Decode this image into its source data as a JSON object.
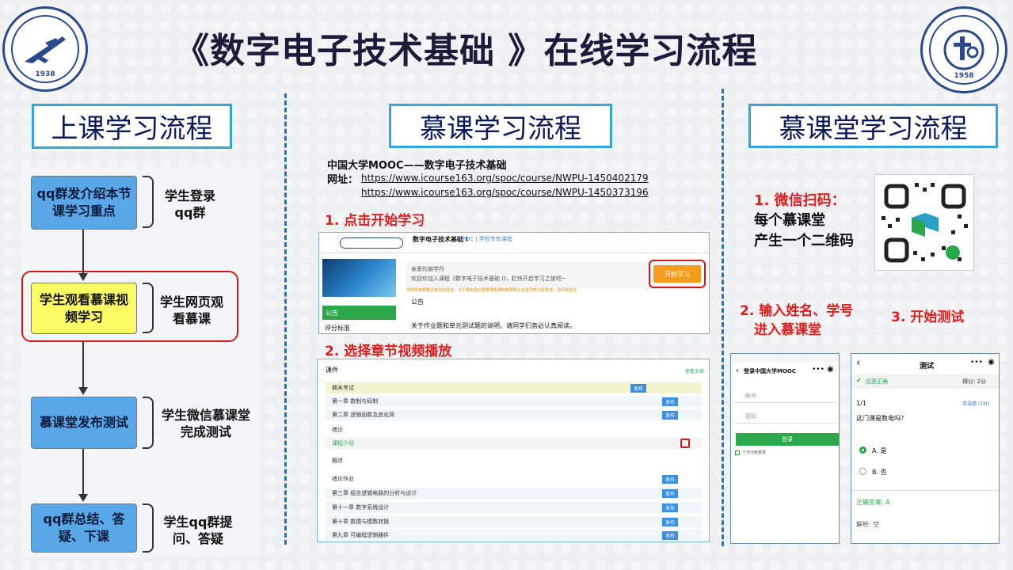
{
  "title": "《数字电子技术基础 》在线学习流程",
  "left_logo": {
    "year": "1938"
  },
  "right_logo": {
    "year": "1958"
  },
  "sections": {
    "class": "上课学习流程",
    "mooc": "慕课学习流程",
    "classroom": "慕课堂学习流程"
  },
  "flow": {
    "steps": [
      {
        "box": "qq群发介绍本节课学习重点",
        "label": "学生登录qq群"
      },
      {
        "box": "学生观看慕课视频学习",
        "label": "学生网页观看慕课"
      },
      {
        "box": "慕课堂发布测试",
        "label": "学生微信慕课堂完成测试"
      },
      {
        "box": "qq群总结、答疑、下课",
        "label": "学生qq群提问、答疑"
      }
    ]
  },
  "mooc": {
    "heading": "中国大学MOOC——数字电子技术基础",
    "url_label": "网址：",
    "url1": "https://www.icourse163.org/spoc/course/NWPU-1450402179",
    "url2": "https://www.icourse163.org/spoc/course/NWPU-1450373196",
    "step1": "1. 点击开始学习",
    "step2": "2. 选择章节视频播放",
    "shot1": {
      "course": "数字电子技术基础 I",
      "tag": "SPOC | 学校专有课程",
      "greeting": "亲爱的谢学丹",
      "welcome": "欢迎你加入课程《数字电子技术基础 I》，赶快开启学习之旅吧~",
      "warning": "你的常用邮箱没有完成验证。为了避免错过重要课程通知和获取认证证书电子版发放，请尽快验证",
      "start": "开始学习",
      "menu": [
        "公告",
        "评分标准"
      ],
      "notice_title": "公告",
      "notice": "关于作业题和单元测试题的说明，请同学们务必认真阅读。"
    },
    "shot2": {
      "header": "课件",
      "expand": "查看全部",
      "rows": [
        "期末考试",
        "第一章 数制与码制",
        "第二章 逻辑函数及其化简",
        "绪论",
        "课程介绍",
        "概述",
        "绪论作业",
        "第三章 组合逻辑电路的分析与设计",
        "第十一章 数字系统设计",
        "第十章 数模与模数转换",
        "第九章 可编程逻辑器件"
      ],
      "tag": "发布"
    }
  },
  "classroom": {
    "step1_title": "1. 微信扫码：",
    "step1_line1": "每个慕课堂",
    "step1_line2": "产生一个二维码",
    "step2_line1": "2. 输入姓名、学号",
    "step2_line2": "进入慕课堂",
    "step3": "3. 开始测试",
    "phone1": {
      "title": "登录中国大学MOOC",
      "field1": "账号",
      "field2": "密码",
      "login": "登录",
      "remember": "十天内免登录"
    },
    "phone2": {
      "title": "测试",
      "correct": "回答正确",
      "score": "得分: 2分",
      "progress": "1/1",
      "qtype": "单选题 (2分)",
      "question": "这门课是数电吗?",
      "opt_a": "A. 是",
      "opt_b": "B. 否",
      "answer": "正确答案: A",
      "analysis": "解析: 空"
    }
  },
  "colors": {
    "accent_blue": "#36a6d8",
    "flow_blue": "#5aa7e8",
    "flow_yellow": "#fbfb66",
    "red": "#e21d1d",
    "orange": "#f39c1e",
    "green": "#2aa84a"
  }
}
